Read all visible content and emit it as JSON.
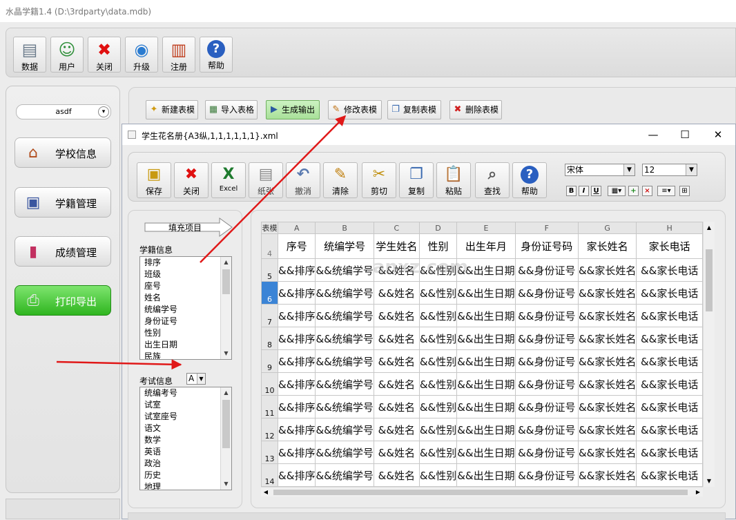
{
  "window": {
    "title": "水晶学籍1.4 (D:\\3rdparty\\data.mdb)"
  },
  "main_toolbar": [
    {
      "label": "数据",
      "icon": "database-icon"
    },
    {
      "label": "用户",
      "icon": "user-icon"
    },
    {
      "label": "关闭",
      "icon": "close-icon"
    },
    {
      "label": "升级",
      "icon": "upgrade-icon"
    },
    {
      "label": "注册",
      "icon": "register-icon"
    },
    {
      "label": "帮助",
      "icon": "help-icon"
    }
  ],
  "left_nav": {
    "user": "asdf",
    "items": [
      {
        "label": "学校信息",
        "icon": "school-icon",
        "active": false
      },
      {
        "label": "学籍管理",
        "icon": "student-card-icon",
        "active": false
      },
      {
        "label": "成绩管理",
        "icon": "bar-chart-icon",
        "active": false
      },
      {
        "label": "打印导出",
        "icon": "printer-icon",
        "active": true
      }
    ]
  },
  "template_toolbar": [
    {
      "label": "新建表模",
      "icon": "new-template-icon"
    },
    {
      "label": "导入表格",
      "icon": "import-icon"
    },
    {
      "label": "生成输出",
      "icon": "generate-icon",
      "active": true
    },
    {
      "label": "修改表模",
      "icon": "edit-template-icon"
    },
    {
      "label": "复制表模",
      "icon": "copy-template-icon"
    },
    {
      "label": "删除表模",
      "icon": "delete-template-icon"
    }
  ],
  "child_window": {
    "title": "学生花名册{A3纵,1,1,1,1,1,1}.xml",
    "toolbar": [
      {
        "label": "保存",
        "icon": "save-icon"
      },
      {
        "label": "关闭",
        "icon": "close-icon"
      },
      {
        "label": "Excel",
        "icon": "excel-icon"
      },
      {
        "label": "纸张",
        "icon": "paper-icon"
      },
      {
        "label": "撤消",
        "icon": "undo-icon"
      },
      {
        "label": "清除",
        "icon": "clear-icon"
      },
      {
        "label": "剪切",
        "icon": "cut-icon"
      },
      {
        "label": "复制",
        "icon": "copy-icon"
      },
      {
        "label": "粘贴",
        "icon": "paste-icon"
      },
      {
        "label": "查找",
        "icon": "find-icon"
      },
      {
        "label": "帮助",
        "icon": "help-icon"
      }
    ],
    "font_name": "宋体",
    "font_size": "12",
    "format_buttons": [
      "B",
      "I",
      "U"
    ]
  },
  "fields": {
    "fill_label": "填充项目",
    "student_group": "学籍信息",
    "student_items": [
      "排序",
      "班级",
      "座号",
      "姓名",
      "统编学号",
      "身份证号",
      "性别",
      "出生日期",
      "民族"
    ],
    "exam_group": "考试信息",
    "exam_selected": "A",
    "exam_items": [
      "统编考号",
      "试室",
      "试室座号",
      "语文",
      "数学",
      "英语",
      "政治",
      "历史",
      "地理"
    ]
  },
  "grid": {
    "corner": "表模",
    "columns": [
      "A",
      "B",
      "C",
      "D",
      "E",
      "F",
      "G",
      "H"
    ],
    "header_row": {
      "num": "4",
      "cells": [
        "序号",
        "统编学号",
        "学生姓名",
        "性别",
        "出生年月",
        "身份证号码",
        "家长姓名",
        "家长电话"
      ]
    },
    "data_row_cells": [
      "&&排序",
      "&&统编学号",
      "&&姓名",
      "&&性别",
      "&&出生日期",
      "&&身份证号",
      "&&家长姓名",
      "&&家长电话"
    ],
    "data_row_nums": [
      "5",
      "6",
      "7",
      "8",
      "9",
      "10",
      "11",
      "12",
      "13",
      "14"
    ],
    "selected_row": "6"
  },
  "watermark": "anxz.com"
}
